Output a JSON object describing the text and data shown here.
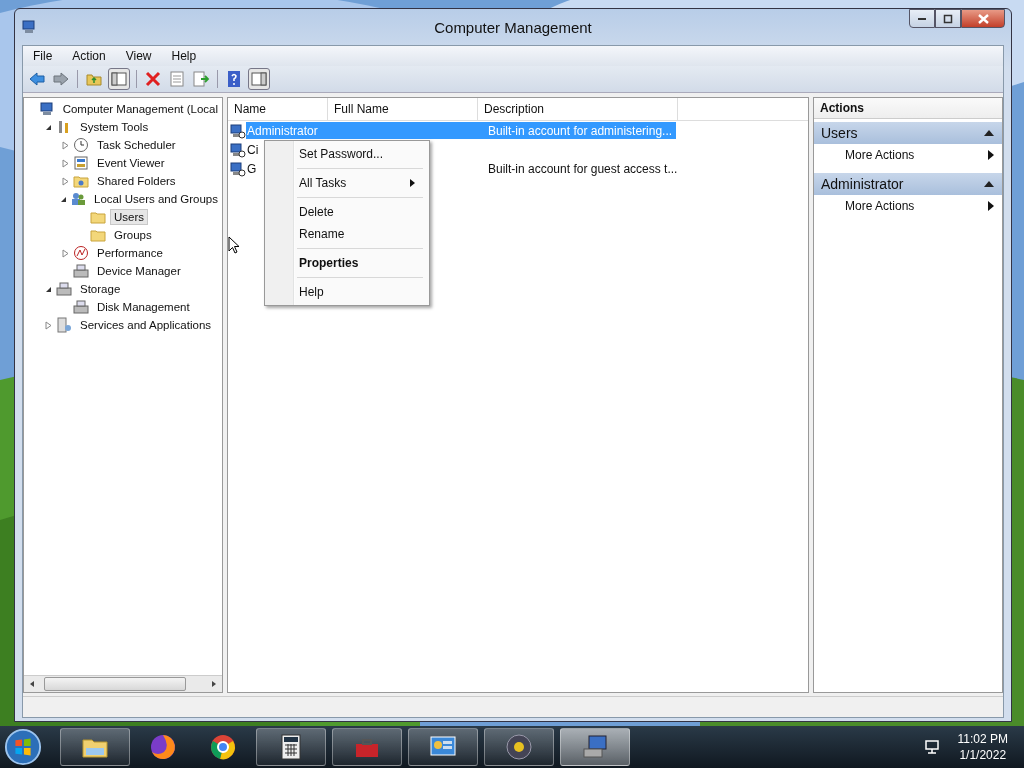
{
  "window": {
    "title": "Computer Management"
  },
  "menu": [
    "File",
    "Action",
    "View",
    "Help"
  ],
  "tree": [
    {
      "label": "Computer Management (Local",
      "selected": false,
      "children": [
        {
          "label": "System Tools",
          "selected": false,
          "expanded": true,
          "children": [
            {
              "label": "Task Scheduler",
              "selected": false,
              "expanded": false
            },
            {
              "label": "Event Viewer",
              "selected": false,
              "expanded": false
            },
            {
              "label": "Shared Folders",
              "selected": false,
              "expanded": false
            },
            {
              "label": "Local Users and Groups",
              "selected": false,
              "expanded": true,
              "children": [
                {
                  "label": "Users",
                  "selected": true
                },
                {
                  "label": "Groups",
                  "selected": false
                }
              ]
            },
            {
              "label": "Performance",
              "selected": false,
              "expanded": false
            },
            {
              "label": "Device Manager",
              "selected": false
            }
          ]
        },
        {
          "label": "Storage",
          "selected": false,
          "expanded": true,
          "children": [
            {
              "label": "Disk Management",
              "selected": false
            }
          ]
        },
        {
          "label": "Services and Applications",
          "selected": false,
          "expanded": false
        }
      ]
    }
  ],
  "table": {
    "columns": [
      "Name",
      "Full Name",
      "Description"
    ],
    "rows": [
      {
        "name": "Administrator",
        "full_name": "",
        "description": "Built-in account for administering...",
        "selected": true
      },
      {
        "name": "Ci",
        "full_name": "",
        "description": "",
        "selected": false
      },
      {
        "name": "G",
        "full_name": "",
        "description": "Built-in account for guest access t...",
        "selected": false
      }
    ]
  },
  "context_menu": [
    [
      {
        "label": "Set Password...",
        "bold": false,
        "submenu": false
      }
    ],
    [
      {
        "label": "All Tasks",
        "bold": false,
        "submenu": true
      }
    ],
    [
      {
        "label": "Delete",
        "bold": false,
        "submenu": false
      },
      {
        "label": "Rename",
        "bold": false,
        "submenu": false
      }
    ],
    [
      {
        "label": "Properties",
        "bold": true,
        "submenu": false
      }
    ],
    [
      {
        "label": "Help",
        "bold": false,
        "submenu": false
      }
    ]
  ],
  "actions": {
    "title": "Actions",
    "sections": [
      {
        "title": "Users",
        "items": [
          "More Actions"
        ]
      },
      {
        "title": "Administrator",
        "items": [
          "More Actions"
        ]
      }
    ]
  },
  "clock": {
    "time": "11:02 PM",
    "date": "1/1/2022"
  }
}
